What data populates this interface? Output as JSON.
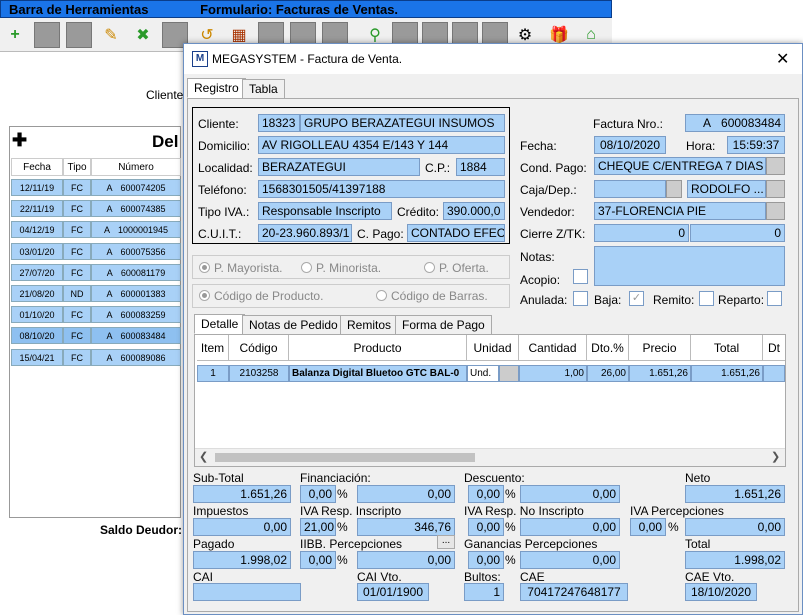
{
  "background": {
    "title_left": "Barra de Herramientas",
    "title_right": "Formulario: Facturas de Ventas.",
    "cliente_label": "Cliente",
    "panel_title": "Del",
    "columns": [
      "Fecha",
      "Tipo",
      "Número"
    ],
    "rows": [
      {
        "fecha": "12/11/19",
        "tipo": "FC",
        "serie": "A",
        "numero": "600074205"
      },
      {
        "fecha": "22/11/19",
        "tipo": "FC",
        "serie": "A",
        "numero": "600074385"
      },
      {
        "fecha": "04/12/19",
        "tipo": "FC",
        "serie": "A",
        "numero": "1000001945"
      },
      {
        "fecha": "03/01/20",
        "tipo": "FC",
        "serie": "A",
        "numero": "600075356"
      },
      {
        "fecha": "27/07/20",
        "tipo": "FC",
        "serie": "A",
        "numero": "600081179"
      },
      {
        "fecha": "21/08/20",
        "tipo": "ND",
        "serie": "A",
        "numero": "600001383"
      },
      {
        "fecha": "01/10/20",
        "tipo": "FC",
        "serie": "A",
        "numero": "600083259"
      },
      {
        "fecha": "08/10/20",
        "tipo": "FC",
        "serie": "A",
        "numero": "600083484"
      },
      {
        "fecha": "15/04/21",
        "tipo": "FC",
        "serie": "A",
        "numero": "600089086"
      }
    ],
    "saldo_label": "Saldo Deudor:"
  },
  "dialog": {
    "title": "MEGASYSTEM - Factura de Venta.",
    "icon_text": "M",
    "close": "✕",
    "tabs": [
      "Registro",
      "Tabla"
    ],
    "cliente_label": "Cliente:",
    "cliente_codigo": "18323",
    "cliente_nombre": "GRUPO BERAZATEGUI INSUMOS",
    "domicilio_label": "Domicilio:",
    "domicilio": "AV RIGOLLEAU 4354 E/143 Y 144",
    "localidad_label": "Localidad:",
    "localidad": "BERAZATEGUI",
    "cp_label": "C.P.:",
    "cp": "1884",
    "telefono_label": "Teléfono:",
    "telefono": "1568301505/41397188",
    "tipo_iva_label": "Tipo IVA.:",
    "tipo_iva": "Responsable Inscripto",
    "credito_label": "Crédito:",
    "credito": "390.000,0",
    "cuit_label": "C.U.I.T.:",
    "cuit": "20-23.960.893/1",
    "cpago_label": "C. Pago:",
    "cpago": "CONTADO EFEC",
    "factura_label": "Factura Nro.:",
    "factura_serie": "A",
    "factura_numero": "600083484",
    "fecha_label": "Fecha:",
    "fecha": "08/10/2020",
    "hora_label": "Hora:",
    "hora": "15:59:37",
    "cond_pago_label": "Cond. Pago:",
    "cond_pago": "CHEQUE C/ENTREGA 7 DIAS",
    "caja_label": "Caja/Dep.:",
    "caja": "",
    "caja_user": "RODOLFO ...",
    "vendedor_label": "Vendedor:",
    "vendedor": "37-FLORENCIA PIE",
    "cierre_label": "Cierre Z/TK:",
    "cierre_1": "0",
    "cierre_2": "0",
    "notas_label": "Notas:",
    "acopio_label": "Acopio:",
    "anulada_label": "Anulada:",
    "baja_label": "Baja:",
    "remito_label": "Remito:",
    "reparto_label": "Reparto:",
    "radio_mayorista": "P. Mayorista.",
    "radio_minorista": "P. Minorista.",
    "radio_oferta": "P. Oferta.",
    "radio_codigo_producto": "Código de Producto.",
    "radio_codigo_barras": "Código de Barras.",
    "detail_tabs": [
      "Detalle",
      "Notas de Pedido",
      "Remitos",
      "Forma de Pago"
    ],
    "grid_headers": [
      "Item",
      "Código",
      "Producto",
      "Unidad",
      "Cantidad",
      "Dto.%",
      "Precio",
      "Total",
      "Dt"
    ],
    "grid_row": {
      "item": "1",
      "codigo": "2103258",
      "producto": "Balanza Digital Bluetoo GTC BAL-0",
      "unidad": "Und.",
      "cantidad": "1,00",
      "dto": "26,00",
      "precio": "1.651,26",
      "total": "1.651,26"
    },
    "totals": {
      "subtotal_label": "Sub-Total",
      "subtotal": "1.651,26",
      "financiacion_label": "Financiación:",
      "financiacion_pct": "0,00",
      "financiacion": "0,00",
      "descuento_label": "Descuento:",
      "descuento_pct": "0,00",
      "descuento": "0,00",
      "neto_label": "Neto",
      "neto": "1.651,26",
      "impuestos_label": "Impuestos",
      "impuestos": "0,00",
      "iva_ri_label": "IVA Resp. Inscripto",
      "iva_ri_pct": "21,00",
      "iva_ri": "346,76",
      "iva_rni_label": "IVA Resp. No Inscripto",
      "iva_rni_pct": "0,00",
      "iva_rni": "0,00",
      "iva_perc_label": "IVA Percepciones",
      "iva_perc_pct": "0,00",
      "iva_perc": "0,00",
      "pagado_label": "Pagado",
      "pagado": "1.998,02",
      "iibb_label": "IIBB. Percepciones",
      "iibb_pct": "0,00",
      "iibb": "0,00",
      "ganancias_label": "Ganancias Percepciones",
      "ganancias_pct": "0,00",
      "ganancias": "0,00",
      "total_label": "Total",
      "total": "1.998,02",
      "cai_label": "CAI",
      "cai": "",
      "cai_vto_label": "CAI Vto.",
      "cai_vto": "01/01/1900",
      "bultos_label": "Bultos:",
      "bultos": "1",
      "cae_label": "CAE",
      "cae": "70417247648177",
      "cae_vto_label": "CAE Vto.",
      "cae_vto": "18/10/2020",
      "percent_sign": "%",
      "ellipsis": "..."
    }
  }
}
